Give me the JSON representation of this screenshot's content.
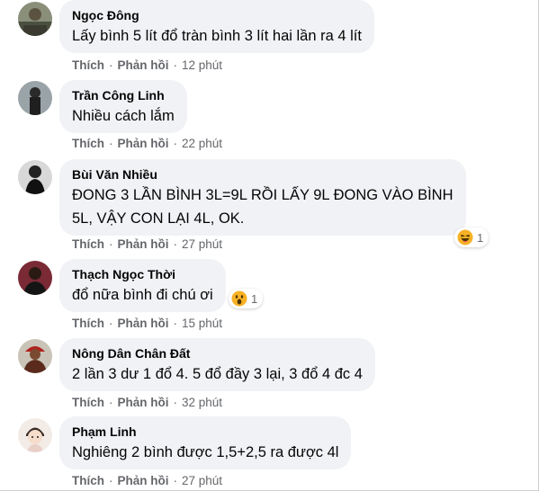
{
  "comments": [
    {
      "author": "Ngọc Đông",
      "lines": [
        "Lấy bình 5 lít đổ tràn bình 3 lít hai lần ra 4 lít"
      ],
      "like": "Thích",
      "reply": "Phản hồi",
      "time": "12 phút"
    },
    {
      "author": "Trần Công Linh",
      "lines": [
        "Nhiều cách lắm"
      ],
      "like": "Thích",
      "reply": "Phản hồi",
      "time": "22 phút"
    },
    {
      "author": "Bùi Văn Nhiều",
      "lines": [
        "ĐONG 3 LẦN BÌNH 3L=9L RỒI LẤY 9L ĐONG VÀO BÌNH",
        "5L, VẬY CON LẠI 4L, OK."
      ],
      "like": "Thích",
      "reply": "Phản hồi",
      "time": "27 phút",
      "reaction": {
        "icon": "haha-reaction-icon",
        "count": "1"
      }
    },
    {
      "author": "Thạch Ngọc Thời",
      "lines": [
        "đổ nữa bình đi chú ơi"
      ],
      "like": "Thích",
      "reply": "Phản hồi",
      "time": "15 phút",
      "reaction": {
        "icon": "wow-reaction-icon",
        "count": "1"
      }
    },
    {
      "author": "Nông Dân Chân Đất",
      "lines": [
        "2 lần 3 dư 1 đổ 4. 5 đổ đầy 3 lại, 3 đổ 4 đc 4"
      ],
      "like": "Thích",
      "reply": "Phản hồi",
      "time": "32 phút"
    },
    {
      "author": "Phạm Linh",
      "lines": [
        "Nghiêng 2 bình được 1,5+2,5 ra được 4l"
      ],
      "like": "Thích",
      "reply": "Phản hồi",
      "time": "27 phút"
    }
  ],
  "colors": {
    "bubble": "#f0f2f5",
    "meta": "#65676b",
    "text": "#050505",
    "reaction": "#f7b125"
  }
}
